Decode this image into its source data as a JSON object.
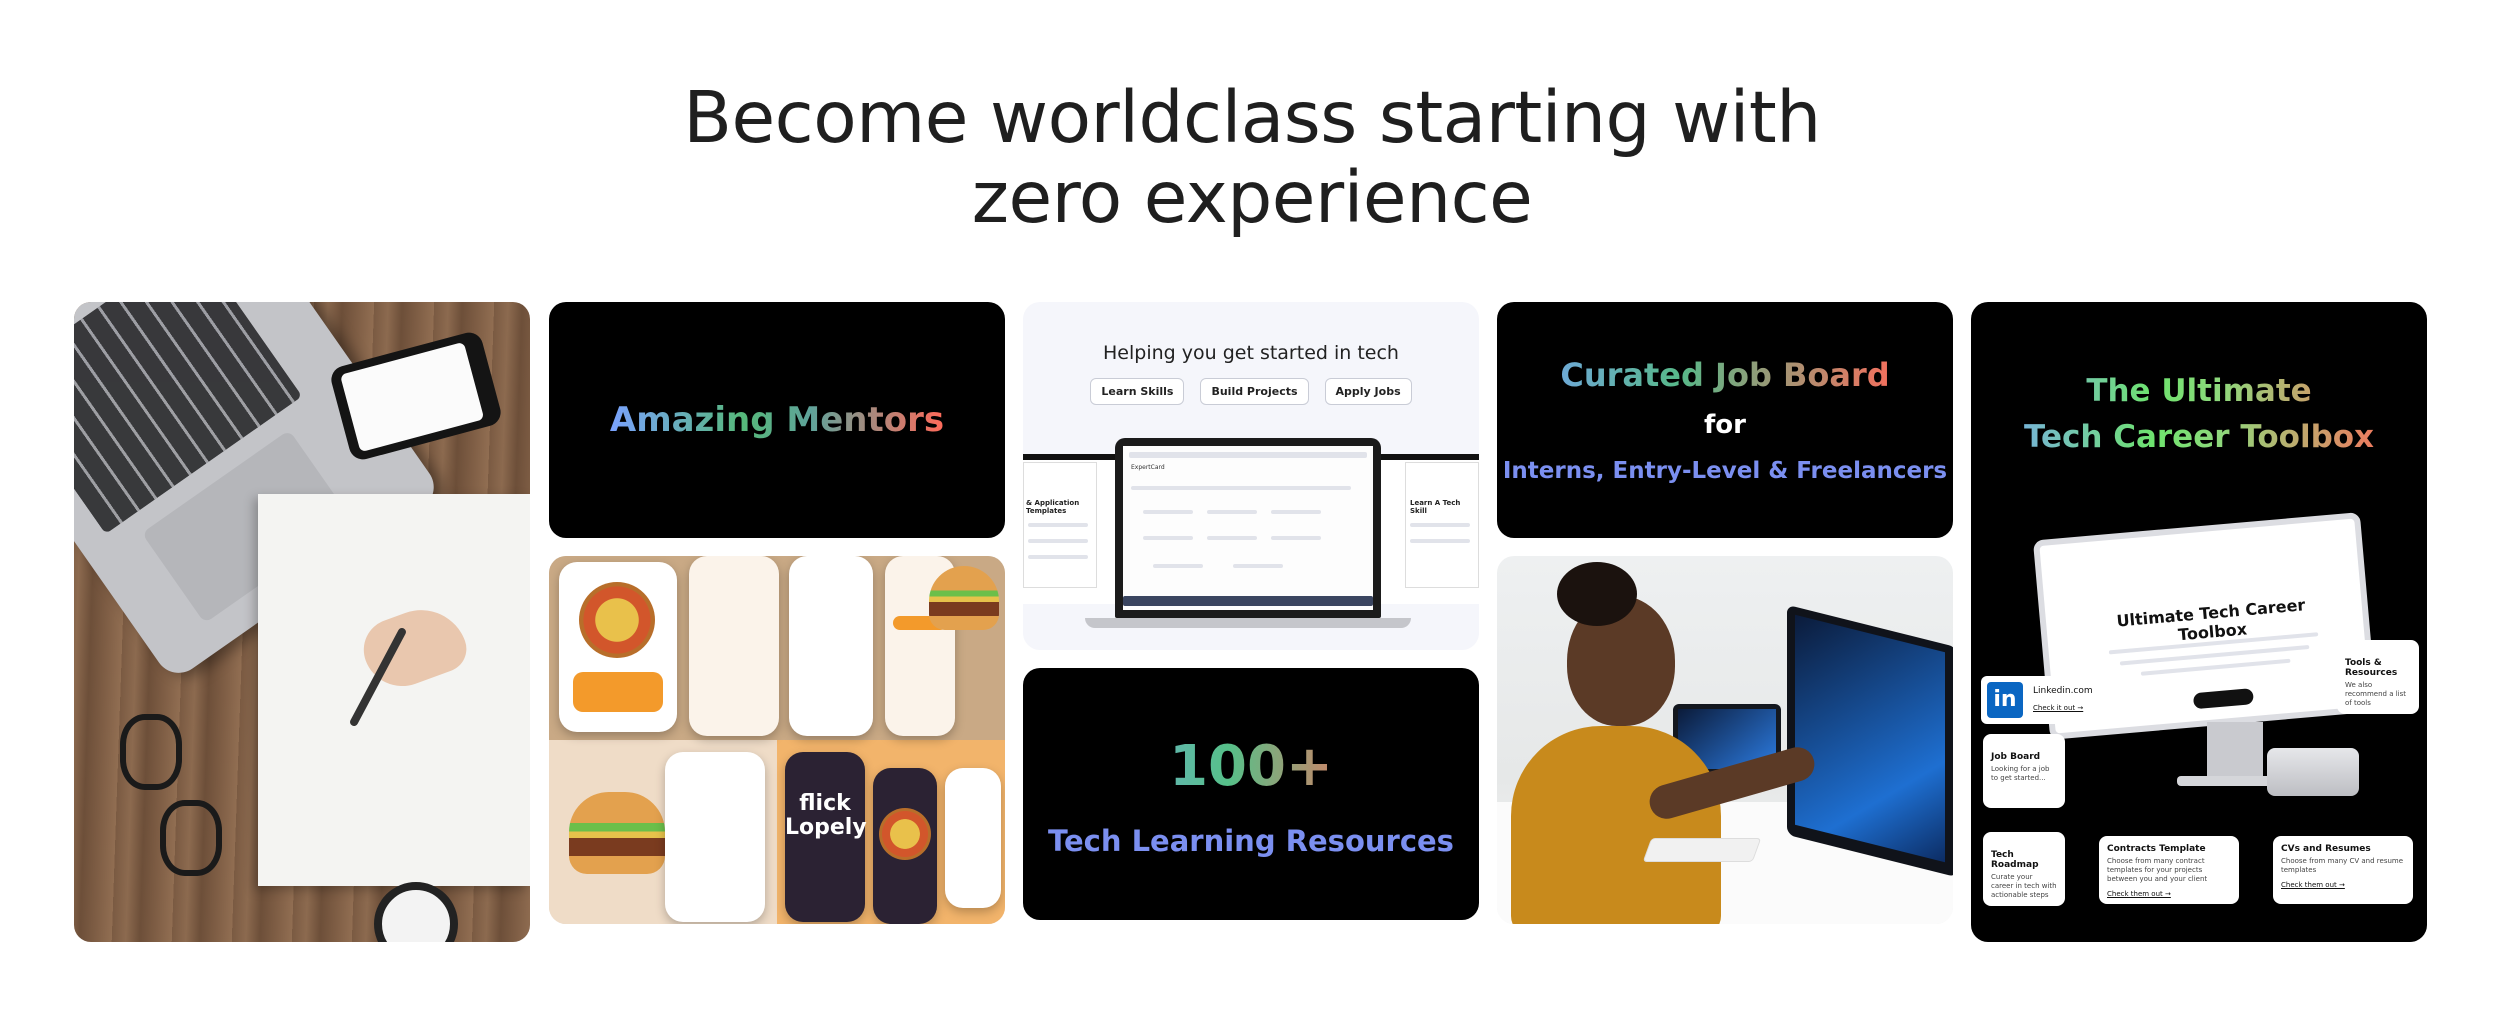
{
  "headline": {
    "line1": "Become worldclass starting with",
    "line2": "zero experience"
  },
  "tiles": {
    "mentors": {
      "title": "Amazing Mentors"
    },
    "food": {
      "brand": "flick Lopely"
    },
    "tech": {
      "title": "Helping you get started in tech",
      "buttons": [
        "Learn Skills",
        "Build Projects",
        "Apply Jobs"
      ],
      "left_heading": "& Application Templates",
      "app_name": "ExpertCard",
      "right_heading": "Learn A Tech Skill"
    },
    "resources": {
      "number": "100+",
      "label": "Tech Learning Resources"
    },
    "jobs": {
      "title": "Curated Job Board",
      "for": "for",
      "subtitle": "Interns, Entry-Level & Freelancers"
    },
    "toolbox": {
      "title_line1": "The Ultimate",
      "title_line2": "Tech Career Toolbox",
      "monitor_title": "Ultimate Tech Career Toolbox",
      "linkedin": {
        "label": "Linkedin.com",
        "link": "Check it out →",
        "icon": "in"
      },
      "cards": [
        {
          "title": "Job Board",
          "text": "Looking for a job to get started..."
        },
        {
          "title": "Tools & Resources",
          "text": "We also recommend a list of tools"
        },
        {
          "title": "Tech Roadmap",
          "text": "Curate your career in tech with actionable steps",
          "link": ""
        },
        {
          "title": "Contracts Template",
          "text": "Choose from many contract templates for your projects between you and your client",
          "link": "Check them out →"
        },
        {
          "title": "CVs and Resumes",
          "text": "Choose from many CV and resume templates",
          "link": "Check them out →"
        }
      ]
    }
  }
}
